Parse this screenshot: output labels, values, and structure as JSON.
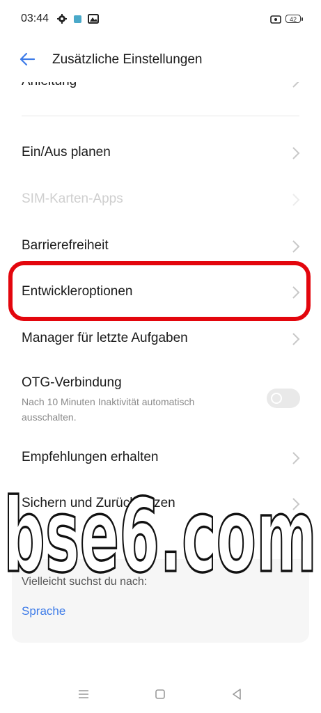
{
  "status_bar": {
    "time": "03:44",
    "battery": "42"
  },
  "header": {
    "title": "Zusätzliche Einstellungen"
  },
  "list": {
    "partial_item": "Anleitung",
    "items": [
      {
        "label": "Ein/Aus planen"
      },
      {
        "label": "SIM-Karten-Apps"
      },
      {
        "label": "Barrierefreiheit"
      },
      {
        "label": "Entwickleroptionen"
      },
      {
        "label": "Manager für letzte Aufgaben"
      },
      {
        "label": "OTG-Verbindung",
        "subtitle": "Nach 10 Minuten Inaktivität automatisch ausschalten."
      },
      {
        "label": "Empfehlungen erhalten"
      },
      {
        "label": "Sichern und Zurücksetzen"
      }
    ]
  },
  "suggestion": {
    "title": "Vielleicht suchst du nach:",
    "link": "Sprache"
  },
  "watermark": "bse6.com",
  "colors": {
    "accent": "#3d7be8",
    "highlight": "#e3060d",
    "disabled": "#cfcfcf"
  }
}
